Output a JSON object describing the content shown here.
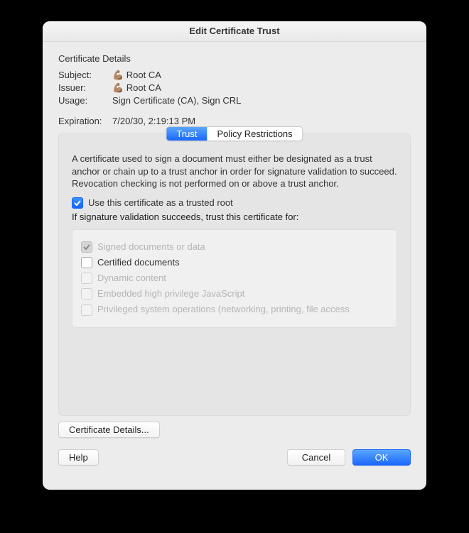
{
  "window": {
    "title": "Edit Certificate Trust"
  },
  "section": {
    "title": "Certificate Details"
  },
  "fields": {
    "subject_label": "Subject:",
    "subject_value": "💪🏽 Root CA",
    "issuer_label": "Issuer:",
    "issuer_value": "💪🏽 Root CA",
    "usage_label": "Usage:",
    "usage_value": "Sign Certificate (CA), Sign CRL",
    "expiration_label": "Expiration:",
    "expiration_value": "7/20/30, 2:19:13 PM"
  },
  "tabs": {
    "trust": "Trust",
    "policy": "Policy Restrictions"
  },
  "trust": {
    "description": "A certificate used to sign a document must either be designated as a trust anchor or chain up to a trust anchor in order for signature validation to succeed.  Revocation checking is not performed on or above a trust anchor.",
    "use_root": "Use this certificate as a trusted root",
    "if_succeeds": "If signature validation succeeds, trust this certificate for:",
    "signed_docs": "Signed documents or data",
    "certified_docs": "Certified documents",
    "dynamic_content": "Dynamic content",
    "embedded_js": "Embedded high privilege JavaScript",
    "privileged_ops": "Privileged system operations (networking, printing, file access"
  },
  "buttons": {
    "details": "Certificate Details...",
    "help": "Help",
    "cancel": "Cancel",
    "ok": "OK"
  }
}
